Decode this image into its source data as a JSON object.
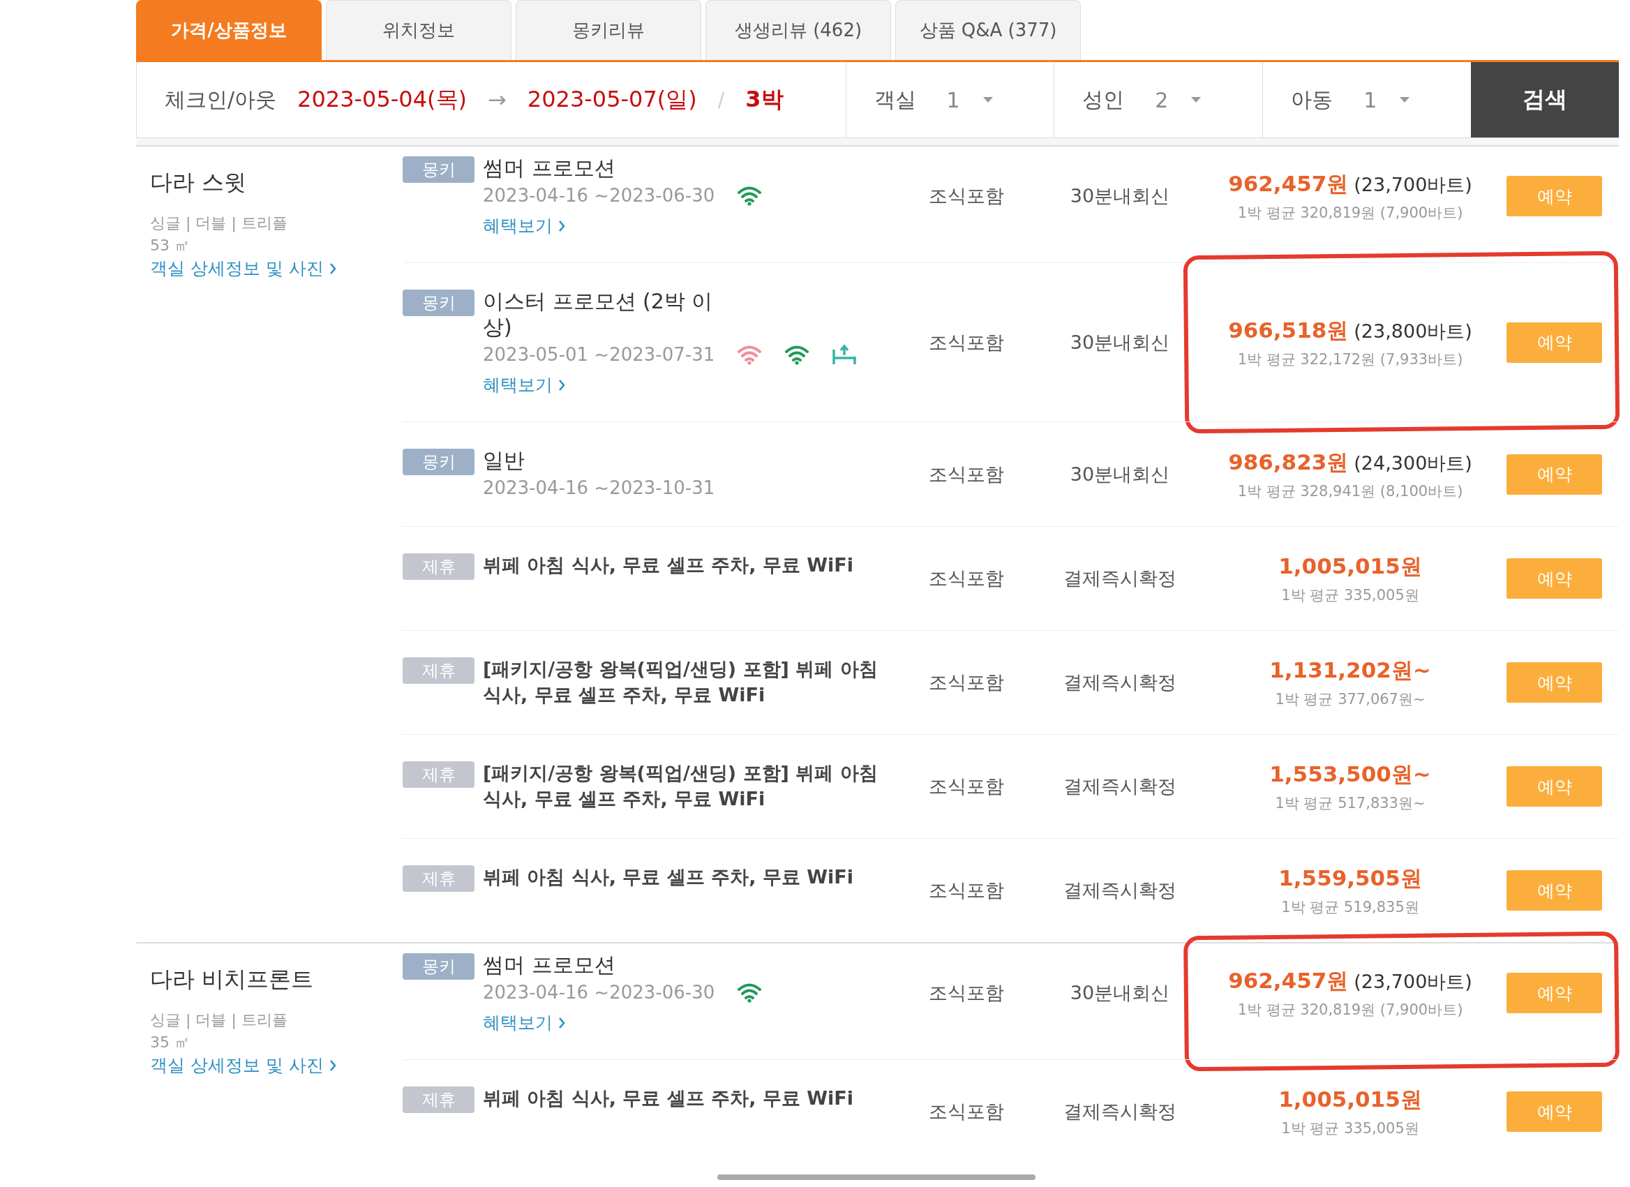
{
  "tabs": [
    {
      "label": "가격/상품정보",
      "selected": true
    },
    {
      "label": "위치정보",
      "selected": false
    },
    {
      "label": "몽키리뷰",
      "selected": false
    },
    {
      "label": "생생리뷰 (462)",
      "selected": false
    },
    {
      "label": "상품 Q&A (377)",
      "selected": false
    }
  ],
  "search_bar": {
    "checkin_label": "체크인/아웃",
    "checkin": "2023-05-04(목)",
    "arrow": "→",
    "checkout": "2023-05-07(일)",
    "separator": "/",
    "nights": "3박",
    "selectors": [
      {
        "label": "객실",
        "value": "1"
      },
      {
        "label": "성인",
        "value": "2"
      },
      {
        "label": "아동",
        "value": "1"
      }
    ],
    "search_button": "검색"
  },
  "rooms": [
    {
      "name": "다라 스윗",
      "bed_types": "싱글 | 더블 | 트리플",
      "size": "53 ㎡",
      "details_link": "객실 상세정보 및 사진",
      "offers": [
        {
          "kind": "mongki",
          "tag": "몽키",
          "title": "썸머 프로모션",
          "dates": "2023-04-16 ~2023-06-30",
          "icons": [
            {
              "kind": "wifi",
              "color": "#1f9a5a"
            }
          ],
          "benefits_link": "혜택보기",
          "meal": "조식포함",
          "confirmation": "30분내회신",
          "price": "962,457원",
          "price_foreign": "(23,700바트)",
          "average": "1박 평균 320,819원 (7,900바트)",
          "button": "예약",
          "marked": false
        },
        {
          "kind": "mongki",
          "tag": "몽키",
          "title": "이스터 프로모션 (2박 이상)",
          "dates": "2023-05-01 ~2023-07-31",
          "icons": [
            {
              "kind": "wifi",
              "color": "#f28b9b"
            },
            {
              "kind": "wifi",
              "color": "#1f9a5a"
            },
            {
              "kind": "bed",
              "color": "#3bb3a6"
            }
          ],
          "benefits_link": "혜택보기",
          "meal": "조식포함",
          "confirmation": "30분내회신",
          "price": "966,518원",
          "price_foreign": "(23,800바트)",
          "average": "1박 평균 322,172원 (7,933바트)",
          "button": "예약",
          "marked": true
        },
        {
          "kind": "mongki",
          "tag": "몽키",
          "title": "일반",
          "dates": "2023-04-16 ~2023-10-31",
          "meal": "조식포함",
          "confirmation": "30분내회신",
          "price": "986,823원",
          "price_foreign": "(24,300바트)",
          "average": "1박 평균 328,941원 (8,100바트)",
          "button": "예약",
          "marked": false
        },
        {
          "kind": "partner",
          "tag": "제휴",
          "title": "뷔페 아침 식사, 무료 셀프 주차, 무료 WiFi",
          "meal": "조식포함",
          "confirmation": "결제즉시확정",
          "price": "1,005,015원",
          "average": "1박 평균 335,005원",
          "button": "예약",
          "marked": false
        },
        {
          "kind": "partner",
          "tag": "제휴",
          "title": "[패키지/공항 왕복(픽업/샌딩) 포함] 뷔페 아침 식사, 무료 셀프 주차, 무료 WiFi",
          "meal": "조식포함",
          "confirmation": "결제즉시확정",
          "price": "1,131,202원~",
          "average": "1박 평균 377,067원~",
          "button": "예약",
          "marked": false
        },
        {
          "kind": "partner",
          "tag": "제휴",
          "title": "[패키지/공항 왕복(픽업/샌딩) 포함] 뷔페 아침 식사, 무료 셀프 주차, 무료 WiFi",
          "meal": "조식포함",
          "confirmation": "결제즉시확정",
          "price": "1,553,500원~",
          "average": "1박 평균 517,833원~",
          "button": "예약",
          "marked": false
        },
        {
          "kind": "partner",
          "tag": "제휴",
          "title": "뷔페 아침 식사, 무료 셀프 주차, 무료 WiFi",
          "meal": "조식포함",
          "confirmation": "결제즉시확정",
          "price": "1,559,505원",
          "average": "1박 평균 519,835원",
          "button": "예약",
          "marked": false
        }
      ]
    },
    {
      "name": "다라 비치프론트",
      "bed_types": "싱글 | 더블 | 트리플",
      "size": "35 ㎡",
      "details_link": "객실 상세정보 및 사진",
      "offers": [
        {
          "kind": "mongki",
          "tag": "몽키",
          "title": "썸머 프로모션",
          "dates": "2023-04-16 ~2023-06-30",
          "icons": [
            {
              "kind": "wifi",
              "color": "#1f9a5a"
            }
          ],
          "benefits_link": "혜택보기",
          "meal": "조식포함",
          "confirmation": "30분내회신",
          "price": "962,457원",
          "price_foreign": "(23,700바트)",
          "average": "1박 평균 320,819원 (7,900바트)",
          "button": "예약",
          "marked": true
        },
        {
          "kind": "partner",
          "tag": "제휴",
          "title": "뷔페 아침 식사, 무료 셀프 주차, 무료 WiFi",
          "meal": "조식포함",
          "confirmation": "결제즉시확정",
          "price": "1,005,015원",
          "average": "1박 평균 335,005원",
          "button": "예약",
          "marked": false
        }
      ]
    }
  ]
}
